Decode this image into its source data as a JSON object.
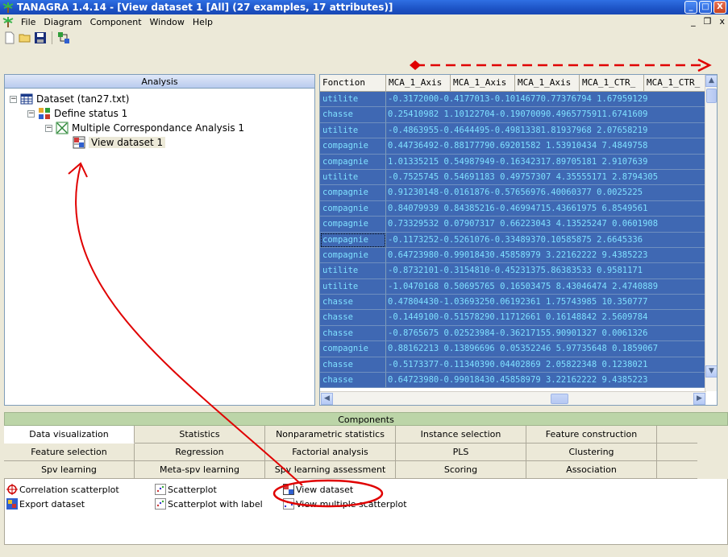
{
  "window": {
    "title": "TANAGRA 1.4.14 - [View dataset 1 [All] (27 examples, 17 attributes)]",
    "minimize": "_",
    "maximize": "□",
    "close": "X"
  },
  "menu": {
    "items": [
      "File",
      "Diagram",
      "Component",
      "Window",
      "Help"
    ],
    "mdi_minimize": "_",
    "mdi_restore": "❐",
    "mdi_close": "x"
  },
  "analysis": {
    "header": "Analysis",
    "nodes": [
      {
        "label": "Dataset (tan27.txt)",
        "expander": "⊟"
      },
      {
        "label": "Define status 1",
        "expander": "⊟"
      },
      {
        "label": "Multiple Correspondance Analysis 1",
        "expander": "⊟"
      },
      {
        "label": "View dataset 1",
        "expander": ""
      }
    ]
  },
  "grid": {
    "columns": [
      "Fonction",
      "MCA_1_Axis",
      "MCA_1_Axis",
      "MCA_1_Axis",
      "MCA_1_CTR_",
      "MCA_1_CTR_"
    ],
    "rows": [
      {
        "fonction": "utilite",
        "values": "-0.3172000-0.4177013-0.10146770.77376794 1.67959129"
      },
      {
        "fonction": "chasse",
        "values": "0.25410982 1.10122704-0.19070090.4965775911.6741609"
      },
      {
        "fonction": "utilite",
        "values": "-0.4863955-0.4644495-0.49813381.81937968 2.07658219"
      },
      {
        "fonction": "compagnie",
        "values": "0.44736492-0.88177790.69201582 1.53910434 7.4849758"
      },
      {
        "fonction": "compagnie",
        "values": "1.01335215 0.54987949-0.16342317.89705181 2.9107639"
      },
      {
        "fonction": "utilite",
        "values": "-0.7525745 0.54691183 0.49757307 4.35555171 2.8794305"
      },
      {
        "fonction": "compagnie",
        "values": "0.91230148-0.0161876-0.57656976.40060377 0.0025225"
      },
      {
        "fonction": "compagnie",
        "values": "0.84079939 0.84385216-0.46994715.43661975 6.8549561"
      },
      {
        "fonction": "compagnie",
        "values": "0.73329532 0.07907317 0.66223043 4.13525247 0.0601908"
      },
      {
        "fonction": "compagnie",
        "values": "-0.1173252-0.5261076-0.33489370.10585875 2.6645336"
      },
      {
        "fonction": "compagnie",
        "values": "0.64723980-0.99018430.45858979 3.22162222 9.4385223"
      },
      {
        "fonction": "utilite",
        "values": "-0.8732101-0.3154810-0.45231375.86383533 0.9581171"
      },
      {
        "fonction": "utilite",
        "values": "-1.0470168 0.50695765 0.16503475 8.43046474 2.4740889"
      },
      {
        "fonction": "chasse",
        "values": "0.47804430-1.03693250.06192361 1.75743985 10.350777"
      },
      {
        "fonction": "chasse",
        "values": "-0.1449100-0.51578290.11712661 0.16148842 2.5609784"
      },
      {
        "fonction": "chasse",
        "values": "-0.8765675 0.02523984-0.36217155.90901327 0.0061326"
      },
      {
        "fonction": "compagnie",
        "values": "0.88162213 0.13896696 0.05352246 5.97735648 0.1859067"
      },
      {
        "fonction": "chasse",
        "values": "-0.5173377-0.11340390.04402869 2.05822348 0.1238021"
      },
      {
        "fonction": "chasse",
        "values": "0.64723980-0.99018430.45858979 3.22162222 9.4385223"
      }
    ],
    "scroll_up": "▲",
    "scroll_left": "◀",
    "scroll_right": "▶",
    "scroll_down": "▼"
  },
  "components": {
    "header": "Components",
    "tabs_row1": [
      "Data visualization",
      "Statistics",
      "Nonparametric statistics",
      "Instance selection",
      "Feature construction"
    ],
    "tabs_row2": [
      "Feature selection",
      "Regression",
      "Factorial analysis",
      "PLS",
      "Clustering"
    ],
    "tabs_row3": [
      "Spv learning",
      "Meta-spv learning",
      "Spv learning assessment",
      "Scoring",
      "Association"
    ],
    "tools": [
      "Correlation scatterplot",
      "Scatterplot",
      "View dataset",
      "Export dataset",
      "Scatterplot with label",
      "View multiple scatterplot"
    ]
  },
  "colors": {
    "title_blue": "#1d53c5",
    "grid_selection": "#3f68b3",
    "grid_text": "#7fe0ff",
    "annotation_red": "#e00000",
    "components_green": "#bcd5a8"
  }
}
